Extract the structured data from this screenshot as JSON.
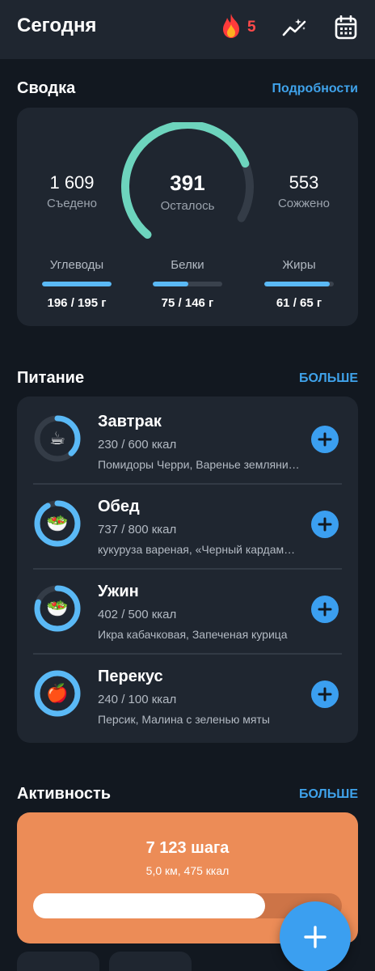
{
  "header": {
    "title": "Сегодня",
    "streak": {
      "count": "5",
      "icon": "flame-icon"
    },
    "icons": [
      "chart-sparkle-icon",
      "calendar-icon"
    ]
  },
  "summary": {
    "title": "Сводка",
    "link": "Подробности",
    "eaten": {
      "value": "1 609",
      "label": "Съедено"
    },
    "remaining": {
      "value": "391",
      "label": "Осталось"
    },
    "burned": {
      "value": "553",
      "label": "Сожжено"
    },
    "remaining_fraction": 0.8,
    "macros": [
      {
        "label": "Углеводы",
        "value": "196 / 195 г",
        "fraction": 1.0
      },
      {
        "label": "Белки",
        "value": "75 / 146 г",
        "fraction": 0.51
      },
      {
        "label": "Жиры",
        "value": "61 / 65 г",
        "fraction": 0.94
      }
    ]
  },
  "nutrition": {
    "title": "Питание",
    "link": "БОЛЬШЕ",
    "meals": [
      {
        "name": "Завтрак",
        "kcal": "230 / 600 ккал",
        "foods": "Помидоры Черри, Варенье земляничное",
        "emoji": "☕",
        "fraction": 0.38
      },
      {
        "name": "Обед",
        "kcal": "737 / 800 ккал",
        "foods": "кукуруза вареная, «Черный кардамон»",
        "emoji": "🥗",
        "fraction": 0.92
      },
      {
        "name": "Ужин",
        "kcal": "402 / 500 ккал",
        "foods": "Икра кабачковая, Запеченая курица",
        "emoji": "🥗",
        "fraction": 0.8
      },
      {
        "name": "Перекус",
        "kcal": "240 / 100 ккал",
        "foods": "Персик, Малина с зеленью мяты",
        "emoji": "🍎",
        "fraction": 1.0
      }
    ]
  },
  "activity": {
    "title": "Активность",
    "link": "БОЛЬШЕ",
    "steps": "7 123 шага",
    "details": "5,0 км, 475 ккал",
    "fraction": 0.75
  },
  "colors": {
    "accent": "#3b9ff0",
    "gauge": "#6dd4bd",
    "macro": "#5ab9f6",
    "activity": "#ec8c57",
    "streak": "#ff4a4a"
  }
}
